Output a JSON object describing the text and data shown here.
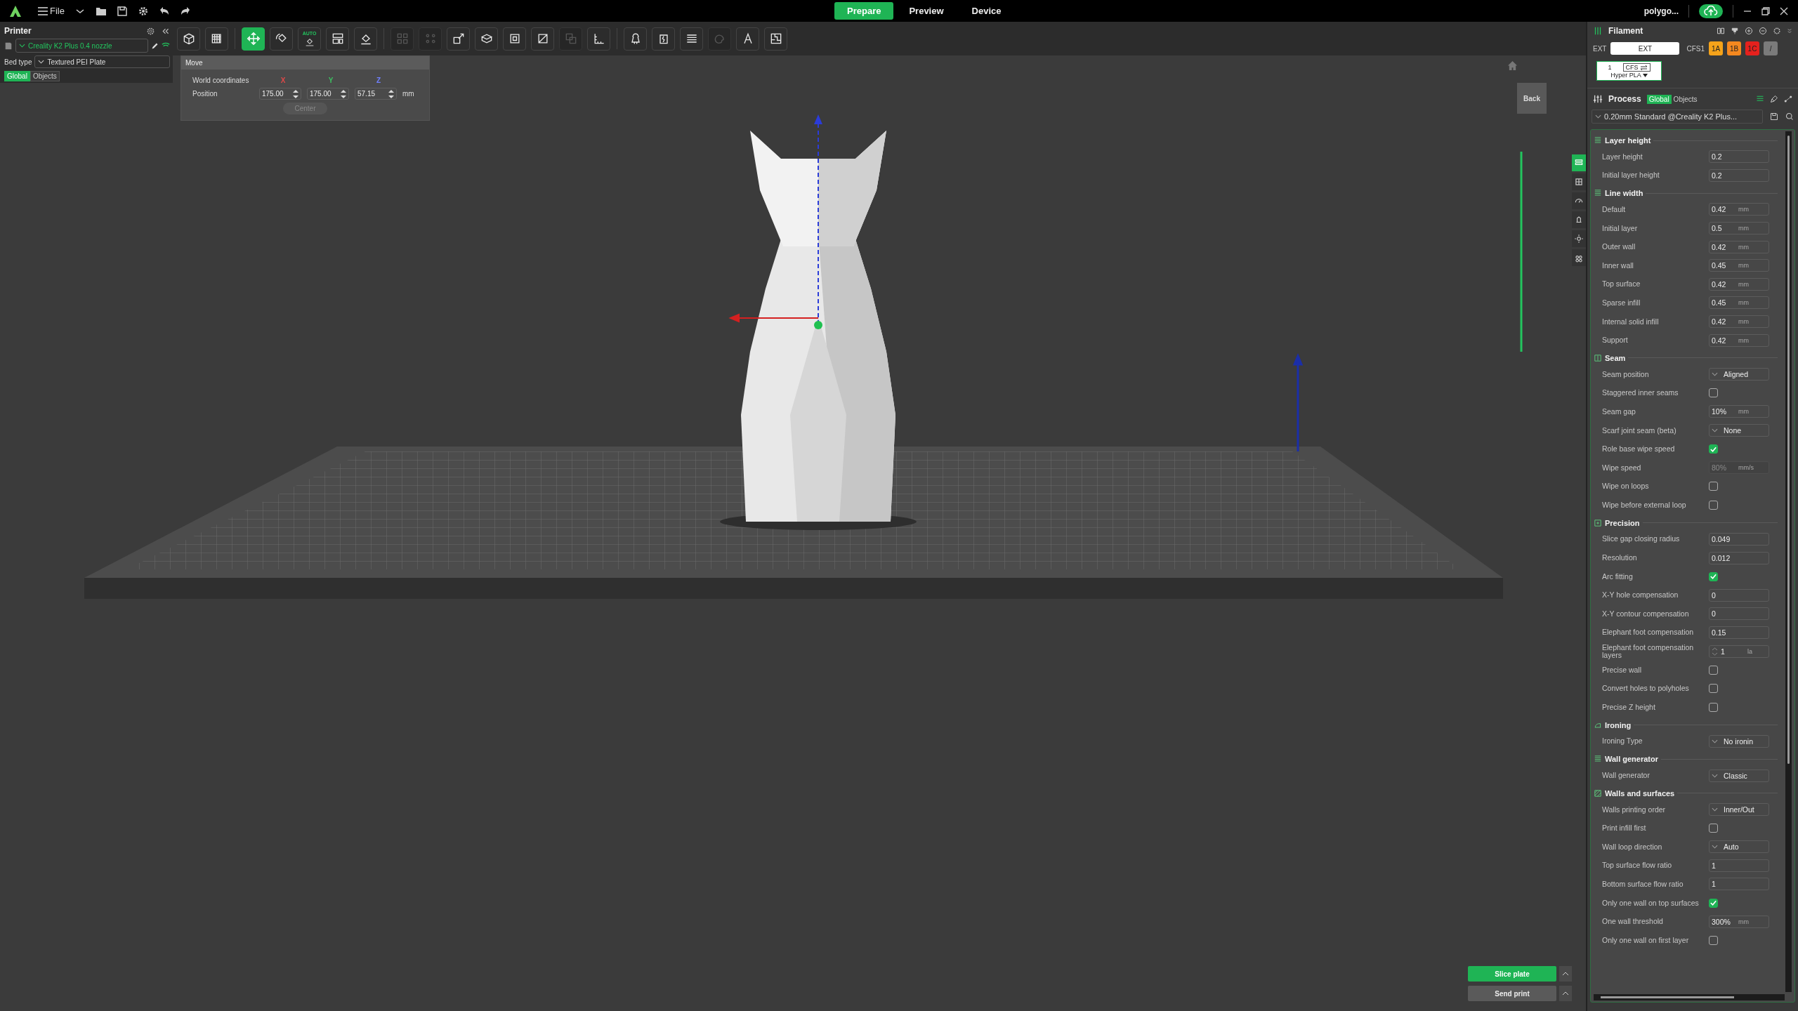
{
  "top_bar": {
    "menu_label": "File",
    "mode_tabs": [
      {
        "label": "Prepare",
        "selected": true
      },
      {
        "label": "Preview",
        "selected": false
      },
      {
        "label": "Device",
        "selected": false
      }
    ],
    "account": "polygo..."
  },
  "printer_panel": {
    "title": "Printer",
    "printer": "Creality K2 Plus 0.4 nozzle",
    "bed_type_label": "Bed type",
    "bed_type": "Textured PEI Plate",
    "scope_tabs": [
      {
        "label": "Global",
        "selected": true
      },
      {
        "label": "Objects",
        "selected": false
      }
    ]
  },
  "toolbar": {
    "groups": [
      [
        {
          "kind": "add_object",
          "selected": false,
          "disabled": false
        },
        {
          "kind": "add_plate",
          "selected": false,
          "disabled": false
        }
      ],
      [
        {
          "kind": "move",
          "selected": true,
          "disabled": false
        },
        {
          "kind": "rotate",
          "selected": false,
          "disabled": false
        },
        {
          "kind": "auto_orient",
          "label": "AUTO",
          "selected": false,
          "disabled": false
        },
        {
          "kind": "arrange",
          "selected": false,
          "disabled": false
        },
        {
          "kind": "lay_on_face",
          "selected": false,
          "disabled": false
        }
      ],
      [
        {
          "kind": "split_objects",
          "selected": false,
          "disabled": true
        },
        {
          "kind": "split_parts",
          "selected": false,
          "disabled": true
        },
        {
          "kind": "scale",
          "selected": false,
          "disabled": false
        },
        {
          "kind": "cut",
          "selected": false,
          "disabled": false
        },
        {
          "kind": "cube",
          "selected": false,
          "disabled": false
        },
        {
          "kind": "slash",
          "selected": false,
          "disabled": false
        },
        {
          "kind": "boolean",
          "selected": false,
          "disabled": true
        },
        {
          "kind": "measure",
          "selected": false,
          "disabled": false
        }
      ],
      [
        {
          "kind": "support_paint",
          "selected": false,
          "disabled": false
        },
        {
          "kind": "seam_paint",
          "selected": false,
          "disabled": false
        },
        {
          "kind": "layers",
          "selected": false,
          "disabled": false
        },
        {
          "kind": "color_paint",
          "selected": false,
          "disabled": true
        },
        {
          "kind": "text",
          "selected": false,
          "disabled": false
        },
        {
          "kind": "assembly",
          "selected": false,
          "disabled": false
        }
      ]
    ]
  },
  "move_panel": {
    "title": "Move",
    "coordinates_label": "World coordinates",
    "axes": [
      {
        "label": "X",
        "color": "#e04848"
      },
      {
        "label": "Y",
        "color": "#3cc060"
      },
      {
        "label": "Z",
        "color": "#7080ff"
      }
    ],
    "position_label": "Position",
    "values": [
      "175.00",
      "175.00",
      "57.15"
    ],
    "unit": "mm",
    "center_button": {
      "label": "Center",
      "disabled": true
    }
  },
  "viewport": {
    "back_button": "Back",
    "side_tabs": [
      {
        "kind": "quality",
        "selected": true
      },
      {
        "kind": "strength",
        "selected": false
      },
      {
        "kind": "speed",
        "selected": false
      },
      {
        "kind": "support",
        "selected": false
      },
      {
        "kind": "others",
        "selected": false
      },
      {
        "kind": "multimaterial",
        "selected": false
      }
    ]
  },
  "actions": {
    "slice_button": "Slice plate",
    "send_button": "Send print"
  },
  "filament": {
    "title": "Filament",
    "ext_label": "EXT",
    "ext_value": "EXT",
    "cfs_label": "CFS1",
    "slots": [
      {
        "label": "1A",
        "color": "#f5a31a"
      },
      {
        "label": "1B",
        "color": "#f4881f"
      },
      {
        "label": "1C",
        "color": "#e5211d"
      },
      {
        "label": "/",
        "color": "#7b7b7b"
      }
    ],
    "card": {
      "index": "1",
      "tag": "CFS",
      "material": "Hyper PLA"
    }
  },
  "process": {
    "title": "Process",
    "scope_tabs": [
      {
        "label": "Global",
        "selected": true
      },
      {
        "label": "Objects",
        "selected": false
      }
    ],
    "preset": "0.20mm Standard @Creality K2 Plus...",
    "groups": [
      {
        "kind": "layers",
        "title": "Layer height",
        "rows": [
          {
            "kind": "number",
            "label": "Layer height",
            "value": "0.2",
            "disabled": false
          },
          {
            "kind": "number",
            "label": "Initial layer height",
            "value": "0.2",
            "disabled": false
          }
        ]
      },
      {
        "kind": "layers",
        "title": "Line width",
        "rows": [
          {
            "kind": "number",
            "label": "Default",
            "value": "0.42",
            "unit": "mm",
            "disabled": false
          },
          {
            "kind": "number",
            "label": "Initial layer",
            "value": "0.5",
            "unit": "mm",
            "disabled": false
          },
          {
            "kind": "number",
            "label": "Outer wall",
            "value": "0.42",
            "unit": "mm",
            "disabled": false
          },
          {
            "kind": "number",
            "label": "Inner wall",
            "value": "0.45",
            "unit": "mm",
            "disabled": false
          },
          {
            "kind": "number",
            "label": "Top surface",
            "value": "0.42",
            "unit": "mm",
            "disabled": false
          },
          {
            "kind": "number",
            "label": "Sparse infill",
            "value": "0.45",
            "unit": "mm",
            "disabled": false
          },
          {
            "kind": "number",
            "label": "Internal solid infill",
            "value": "0.42",
            "unit": "mm",
            "disabled": false
          },
          {
            "kind": "number",
            "label": "Support",
            "value": "0.42",
            "unit": "mm",
            "disabled": false
          }
        ]
      },
      {
        "kind": "seam",
        "title": "Seam",
        "rows": [
          {
            "kind": "select",
            "label": "Seam position",
            "value": "Aligned",
            "disabled": false
          },
          {
            "kind": "checkbox",
            "label": "Staggered inner seams",
            "checked": false,
            "disabled": false
          },
          {
            "kind": "number",
            "label": "Seam gap",
            "value": "10%",
            "unit": "mm",
            "disabled": false
          },
          {
            "kind": "select",
            "label": "Scarf joint seam (beta)",
            "value": "None",
            "disabled": false
          },
          {
            "kind": "checkbox",
            "label": "Role base wipe speed",
            "checked": true,
            "disabled": false
          },
          {
            "kind": "number",
            "label": "Wipe speed",
            "value": "80%",
            "unit": "mm/s",
            "disabled": true
          },
          {
            "kind": "checkbox",
            "label": "Wipe on loops",
            "checked": false,
            "disabled": false
          },
          {
            "kind": "checkbox",
            "label": "Wipe before external loop",
            "checked": false,
            "disabled": false
          }
        ]
      },
      {
        "kind": "precision",
        "title": "Precision",
        "rows": [
          {
            "kind": "number",
            "label": "Slice gap closing radius",
            "value": "0.049",
            "disabled": false
          },
          {
            "kind": "number",
            "label": "Resolution",
            "value": "0.012",
            "disabled": false
          },
          {
            "kind": "checkbox",
            "label": "Arc fitting",
            "checked": true,
            "disabled": false
          },
          {
            "kind": "number",
            "label": "X-Y hole compensation",
            "value": "0",
            "disabled": false
          },
          {
            "kind": "number",
            "label": "X-Y contour compensation",
            "value": "0",
            "disabled": false
          },
          {
            "kind": "number",
            "label": "Elephant foot compensation",
            "value": "0.15",
            "disabled": false
          },
          {
            "kind": "spin",
            "label": "Elephant foot compensation layers",
            "value": "1",
            "unit": "la",
            "disabled": false
          },
          {
            "kind": "checkbox",
            "label": "Precise wall",
            "checked": false,
            "disabled": false
          },
          {
            "kind": "checkbox",
            "label": "Convert holes to polyholes",
            "checked": false,
            "disabled": false
          },
          {
            "kind": "checkbox",
            "label": "Precise Z height",
            "checked": false,
            "disabled": false
          }
        ]
      },
      {
        "kind": "ironing",
        "title": "Ironing",
        "rows": [
          {
            "kind": "select",
            "label": "Ironing Type",
            "value": "No ironin",
            "disabled": false
          }
        ]
      },
      {
        "kind": "layers",
        "title": "Wall generator",
        "rows": [
          {
            "kind": "select",
            "label": "Wall generator",
            "value": "Classic",
            "disabled": false
          }
        ]
      },
      {
        "kind": "walls",
        "title": "Walls and surfaces",
        "rows": [
          {
            "kind": "select",
            "label": "Walls printing order",
            "value": "Inner/Out",
            "disabled": false
          },
          {
            "kind": "checkbox",
            "label": "Print infill first",
            "checked": false,
            "disabled": false
          },
          {
            "kind": "select",
            "label": "Wall loop direction",
            "value": "Auto",
            "disabled": false
          },
          {
            "kind": "number",
            "label": "Top surface flow ratio",
            "value": "1",
            "disabled": false
          },
          {
            "kind": "number",
            "label": "Bottom surface flow ratio",
            "value": "1",
            "disabled": false
          },
          {
            "kind": "checkbox",
            "label": "Only one wall on top surfaces",
            "checked": true,
            "disabled": false
          },
          {
            "kind": "number",
            "label": "One wall threshold",
            "value": "300%",
            "unit": "mm",
            "disabled": false
          },
          {
            "kind": "checkbox",
            "label": "Only one wall on first layer",
            "checked": false,
            "disabled": false
          }
        ]
      }
    ]
  }
}
